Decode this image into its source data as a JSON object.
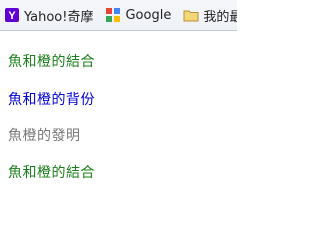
{
  "bookmarks": [
    {
      "label": "Yahoo!奇摩",
      "icon": "yahoo-icon",
      "color": "#6001d2"
    },
    {
      "label": "Google",
      "icon": "google-icon"
    },
    {
      "label": "我的最",
      "icon": "folder-icon",
      "color": "#e8c14a"
    }
  ],
  "lines": [
    {
      "text": "魚和橙的結合",
      "color": "#1a7f1a"
    },
    {
      "text": "魚和橙的背份",
      "color": "#0000d8"
    },
    {
      "text": "魚橙的發明",
      "color": "#777777"
    },
    {
      "text": "魚和橙的結合",
      "color": "#1a7f1a"
    }
  ]
}
